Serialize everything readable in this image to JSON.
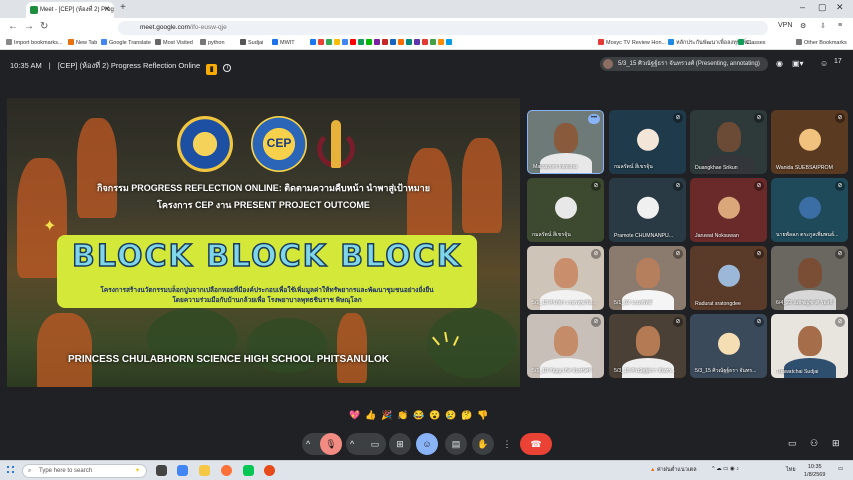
{
  "browser": {
    "tab_title": "Meet - [CEP] (ห้องที่ 2) Prog",
    "url_host": "meet.google.com",
    "url_path": "/ifo-eusw-qje",
    "vpn_label": "VPN",
    "bookmarks": [
      "Import bookmarks...",
      "New Tab",
      "Google Translate",
      "Most Visited",
      "python",
      "Sudjai",
      "MWIT",
      "Mosyc TV Review Hon...",
      "หลักประกันพัฒนาเพื่อลงทุนเพิ่ม...",
      "Classes",
      "Other Bookmarks"
    ]
  },
  "meet": {
    "time": "10:35 AM",
    "separator": "|",
    "meeting_title": "[CEP] (ห้องที่ 2) Progress Reflection Online",
    "presenter_label": "5/3_15 ศิวณัฐฐ์ธรา จันทรวงศ์ (Presenting, annotating)",
    "participant_count": "17"
  },
  "slide": {
    "heading_line1": "กิจกรรม PROGRESS REFLECTION ONLINE: ติดตามความคืบหน้า นำพาสู่เป้าหมาย",
    "heading_line2": "โครงการ CEP งาน PRESENT PROJECT OUTCOME",
    "logo_text": "CEP",
    "block_title": "BLOCK BLOCK BLOCK",
    "box_line1": "โครงการสร้างนวัตกรรมบล็อกปูนจากเปลือกหอยที่มีองค์ประกอบเพื่อใช้เพิ่มมูลค่าให้ทรัพยากรและพัฒนาชุมชนอย่างยั่งยืน",
    "box_line2": "โดยความร่วมมือกับบ้านกล้วยเพื่อ โรงพยาบาลพุทธชินราช พิษณุโลก",
    "school": "PRINCESS CHULABHORN SCIENCE HIGH SCHOOL PHITSANULOK"
  },
  "participants": [
    {
      "name": "Mathayom Inthicha"
    },
    {
      "name": "กมลรัตน์ สีเขรจุ้น"
    },
    {
      "name": "Duangkhae Srikun"
    },
    {
      "name": "Wanida SUEBSAIPROM"
    },
    {
      "name": "กมลรัตน์ สีเขรจุ้น"
    },
    {
      "name": "Pramote CHUMNANPU..."
    },
    {
      "name": "Jaruwat Noksuwan"
    },
    {
      "name": "นายพัลลภ ตระกูลเพิ่มพนธ์..."
    },
    {
      "name": "5/1_15 ศิรภัทร เกษรสุขเรือ..."
    },
    {
      "name": "5/1_02 นนทพัทธิ์"
    },
    {
      "name": "Radurat sratongdee"
    },
    {
      "name": "6/4_23 ณพิชญ์ชาติ รองชื่"
    },
    {
      "name": "5/1_10 กัญญาภัส จันทร์ศรี"
    },
    {
      "name": "5/3_15 ศิวณัฐฐ์ธรา จันทร..."
    },
    {
      "name": "5/3_15 ศิวณัฐฐ์ธรา จันทร..."
    },
    {
      "name": "Thawatchai Sudjai"
    }
  ],
  "reactions": [
    "💖",
    "👍",
    "🎉",
    "👏",
    "😂",
    "😮",
    "😢",
    "🤔",
    "👎"
  ],
  "controls": {
    "hangup_tooltip": "Leave call"
  },
  "taskbar": {
    "search_placeholder": "Type here to search",
    "weather": "ค่าฝนต่ำแนวเตล",
    "lang": "ไทย",
    "time": "10:35",
    "date": "1/8/2569"
  },
  "colors": {
    "meet_bg": "#202124",
    "accent_blue": "#8ab4f8",
    "hangup_red": "#ea4335",
    "slide_green": "#d4e83a"
  }
}
